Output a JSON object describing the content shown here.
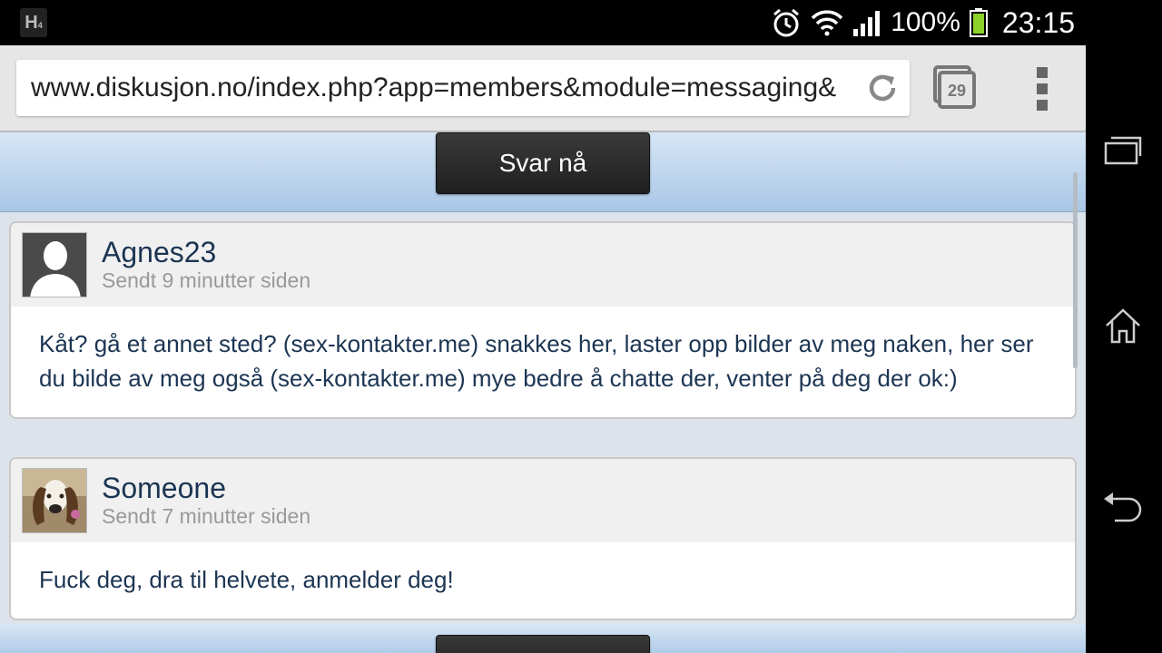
{
  "status_bar": {
    "app_icon_letter": "H",
    "app_icon_sub": "4",
    "battery_percent": "100%",
    "time": "23:15",
    "icons": [
      "alarm-icon",
      "wifi-icon",
      "signal-icon",
      "battery-icon"
    ]
  },
  "browser": {
    "url": "www.diskusjon.no/index.php?app=members&module=messaging&",
    "tab_count": "29",
    "icons": [
      "reload-icon",
      "tabs-icon",
      "overflow-menu-icon"
    ]
  },
  "actions": {
    "reply_label": "Svar nå"
  },
  "messages": [
    {
      "author": "Agnes23",
      "sent": "Sendt 9 minutter siden",
      "body": "Kåt? gå et annet sted? (sex-kontakter.me) snakkes her, laster opp bilder av meg naken, her ser du bilde av meg også (sex-kontakter.me) mye bedre å chatte der, venter på deg der ok:)"
    },
    {
      "author": "Someone",
      "sent": "Sendt 7 minutter siden",
      "body": "Fuck deg, dra til helvete, anmelder deg!"
    }
  ],
  "nav_bar": {
    "icons": [
      "recent-apps-icon",
      "home-icon",
      "back-icon"
    ]
  },
  "colors": {
    "accent_text": "#1c3553",
    "header_blue": "#a9c7e6",
    "button_dark": "#2a2a2a"
  }
}
